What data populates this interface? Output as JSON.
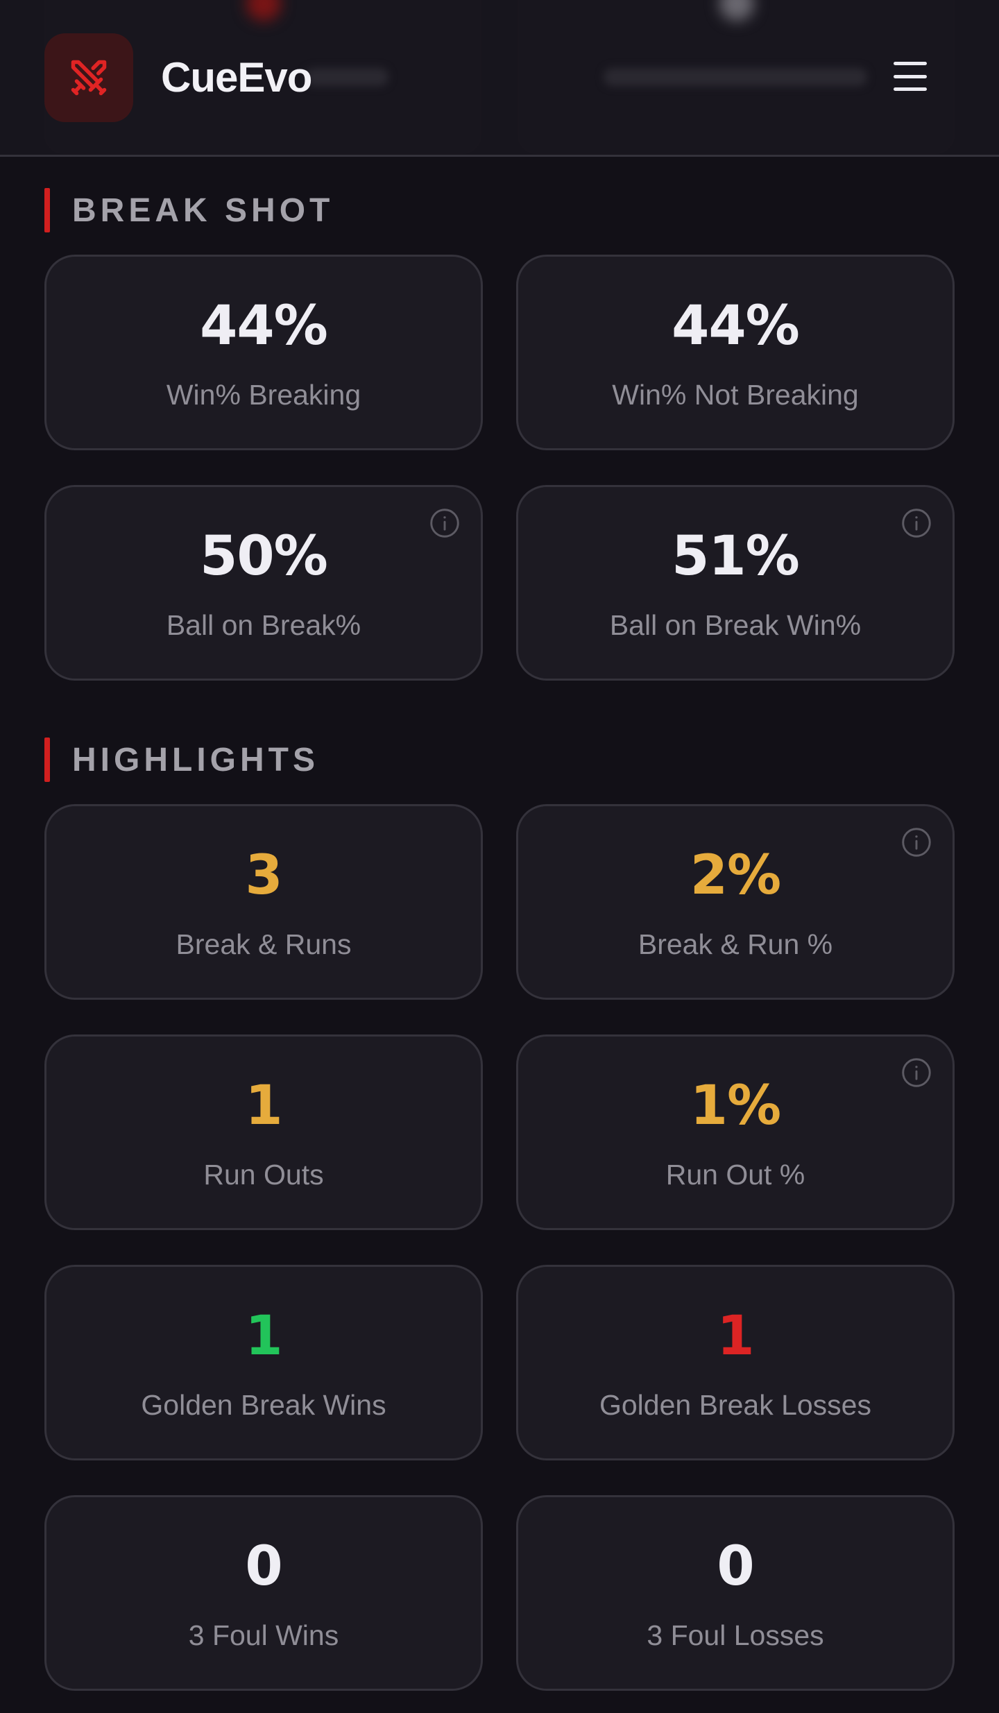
{
  "app": {
    "name": "CueEvo",
    "logo_icon": "crossed-swords-icon",
    "accent": "#d11f1f"
  },
  "sections": {
    "break_shot": {
      "title": "BREAK SHOT",
      "cards": [
        {
          "value": "44%",
          "label": "Win% Breaking"
        },
        {
          "value": "44%",
          "label": "Win% Not Breaking"
        },
        {
          "value": "50%",
          "label": "Ball on Break%",
          "info_icon": "info-icon"
        },
        {
          "value": "51%",
          "label": "Ball on Break Win%",
          "info_icon": "info-icon"
        }
      ]
    },
    "highlights": {
      "title": "HIGHLIGHTS",
      "cards": [
        {
          "value": "3",
          "label": "Break & Runs",
          "color": "#e6ab3c"
        },
        {
          "value": "2%",
          "label": "Break & Run %",
          "color": "#e6ab3c",
          "info_icon": "info-icon"
        },
        {
          "value": "1",
          "label": "Run Outs",
          "color": "#e6ab3c"
        },
        {
          "value": "1%",
          "label": "Run Out %",
          "color": "#e6ab3c",
          "info_icon": "info-icon"
        },
        {
          "value": "1",
          "label": "Golden Break Wins",
          "color": "#22c45a"
        },
        {
          "value": "1",
          "label": "Golden Break Losses",
          "color": "#dc2424"
        },
        {
          "value": "0",
          "label": "3 Foul Wins"
        },
        {
          "value": "0",
          "label": "3 Foul Losses"
        }
      ]
    }
  }
}
